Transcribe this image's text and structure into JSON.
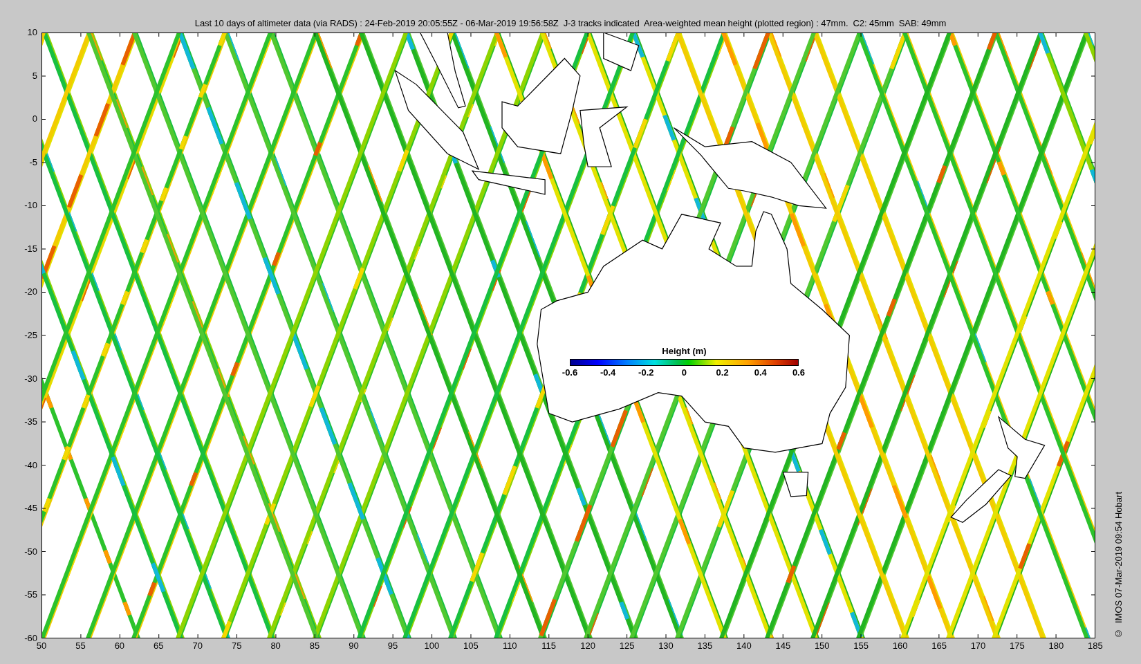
{
  "title": "Last 10 days of altimeter data (via RADS) : 24-Feb-2019 20:05:55Z - 06-Mar-2019 19:56:58Z  J-3 tracks indicated  Area-weighted mean height (plotted region) : 47mm.  C2: 45mm  SAB: 49mm",
  "plot": {
    "yticks": [
      "10",
      "5",
      "0",
      "-5",
      "-10",
      "-15",
      "-20",
      "-25",
      "-30",
      "-35",
      "-40",
      "-45",
      "-50",
      "-55",
      "-60"
    ],
    "xticks": [
      "50",
      "55",
      "60",
      "65",
      "70",
      "75",
      "80",
      "85",
      "90",
      "95",
      "100",
      "105",
      "110",
      "115",
      "120",
      "125",
      "130",
      "135",
      "140",
      "145",
      "150",
      "155",
      "160",
      "165",
      "170",
      "175",
      "180",
      "185"
    ]
  },
  "colorbar": {
    "title": "Height (m)",
    "ticks": [
      "-0.6",
      "-0.4",
      "-0.2",
      "0",
      "0.2",
      "0.4",
      "0.6"
    ]
  },
  "credit": "©  IMOS 07-Mar-2019 09:54 Hobart"
}
